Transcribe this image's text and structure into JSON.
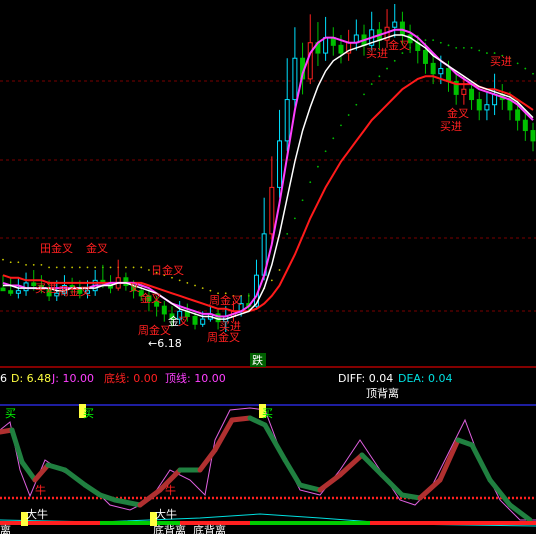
{
  "colors": {
    "background": "#000000",
    "grid": "#7a0000",
    "separator": "#b00000",
    "up_candle": "#00e0ff",
    "down_candle": "#00c000",
    "up_body_red": "#ff2020",
    "signal_bar": "#ffff40",
    "ma_white": "#ffffff",
    "ma_magenta": "#ff40ff",
    "ma_red": "#ff1a1a",
    "dot_line": "#c8c800",
    "label_red": "#ff2020",
    "osc_magenta": "#e060e0",
    "osc_up": "#b03030",
    "osc_down": "#208040",
    "blue_line": "#3030ff",
    "dea_cyan": "#00e0e0",
    "level_red": "#ff2020"
  },
  "upper_labels": [
    {
      "text": "田金叉",
      "key": "l1"
    },
    {
      "text": "金叉",
      "key": "l2"
    },
    {
      "text": "买进",
      "key": "l3"
    },
    {
      "text": "周金叉",
      "key": "l4"
    },
    {
      "text": "日金叉",
      "key": "l5"
    },
    {
      "text": "叉",
      "key": "l6"
    },
    {
      "text": "金叉",
      "key": "l7"
    },
    {
      "text": "周金叉",
      "key": "l8"
    },
    {
      "text": "买进",
      "key": "l9"
    },
    {
      "text": "周金叉",
      "key": "l10"
    },
    {
      "text": "金",
      "key": "l11"
    },
    {
      "text": "叉",
      "key": "l12"
    },
    {
      "text": "周金叉",
      "key": "l13"
    },
    {
      "text": "买进",
      "key": "l14"
    },
    {
      "text": "买进",
      "key": "l15"
    },
    {
      "text": "金叉",
      "key": "l16"
    },
    {
      "text": "买进",
      "key": "l17"
    },
    {
      "text": "金叉",
      "key": "l18"
    }
  ],
  "low_price_label": "←6.18",
  "down_marker": "跌",
  "indicator_header": {
    "k_prefix": "6",
    "d_label": "D: 6.48",
    "j_label": "J: 10.00",
    "bottom_line_label": "底线: 0.00",
    "top_line_label": "顶线: 10.00",
    "diff_label": "DIFF: 0.04",
    "dea_label": "DEA: 0.04",
    "top_divergence": "顶背离"
  },
  "osc_markers": {
    "buy1": "买",
    "buy2": "买",
    "buy3": "买",
    "bull1_red": "牛",
    "bull2_red": "牛",
    "bull1": "大牛",
    "bull2": "大牛",
    "bottom_div1": "底背离",
    "bottom_div2": "底背离",
    "edge_text": "离"
  },
  "chart_data": {
    "type": "candlestick",
    "candles": [
      [
        9,
        8,
        14,
        8
      ],
      [
        8,
        7,
        13,
        6
      ],
      [
        7,
        8,
        13,
        5
      ],
      [
        8,
        11,
        15,
        6
      ],
      [
        11,
        10,
        16,
        8
      ],
      [
        10,
        9,
        14,
        7
      ],
      [
        9,
        6,
        12,
        4
      ],
      [
        6,
        7,
        12,
        4
      ],
      [
        7,
        10,
        14,
        6
      ],
      [
        10,
        9,
        13,
        7
      ],
      [
        9,
        7,
        12,
        5
      ],
      [
        7,
        8,
        12,
        5
      ],
      [
        8,
        12,
        16,
        6
      ],
      [
        12,
        11,
        18,
        9
      ],
      [
        11,
        9,
        14,
        7
      ],
      [
        9,
        13,
        20,
        8
      ],
      [
        13,
        10,
        15,
        8
      ],
      [
        10,
        8,
        12,
        5
      ],
      [
        8,
        6,
        11,
        4
      ],
      [
        6,
        4,
        9,
        0
      ],
      [
        4,
        2,
        6,
        -2
      ],
      [
        2,
        -1,
        4,
        -4
      ],
      [
        -1,
        -3,
        2,
        -6
      ],
      [
        -3,
        0,
        4,
        -5
      ],
      [
        0,
        -2,
        3,
        -4
      ],
      [
        -2,
        -5,
        0,
        -7
      ],
      [
        -5,
        -3,
        0,
        -6
      ],
      [
        -3,
        -1,
        2,
        -4
      ],
      [
        -1,
        -4,
        1,
        -7
      ],
      [
        -4,
        -2,
        2,
        -8
      ],
      [
        -2,
        0,
        4,
        -4
      ],
      [
        0,
        3,
        6,
        -2
      ],
      [
        3,
        2,
        7,
        0
      ],
      [
        2,
        14,
        20,
        1
      ],
      [
        14,
        30,
        44,
        12
      ],
      [
        30,
        48,
        60,
        27
      ],
      [
        48,
        66,
        78,
        44
      ],
      [
        66,
        82,
        98,
        62
      ],
      [
        82,
        98,
        110,
        78
      ],
      [
        98,
        90,
        104,
        84
      ],
      [
        90,
        104,
        115,
        88
      ],
      [
        104,
        100,
        112,
        95
      ],
      [
        100,
        106,
        114,
        97
      ],
      [
        106,
        103,
        110,
        99
      ],
      [
        103,
        100,
        107,
        96
      ],
      [
        100,
        104,
        109,
        97
      ],
      [
        104,
        107,
        113,
        101
      ],
      [
        107,
        103,
        111,
        99
      ],
      [
        103,
        109,
        116,
        101
      ],
      [
        109,
        105,
        112,
        101
      ],
      [
        105,
        110,
        117,
        102
      ],
      [
        110,
        112,
        119,
        106
      ],
      [
        112,
        107,
        116,
        103
      ],
      [
        107,
        104,
        111,
        100
      ],
      [
        104,
        101,
        107,
        96
      ],
      [
        101,
        96,
        104,
        92
      ],
      [
        96,
        92,
        100,
        88
      ],
      [
        92,
        94,
        99,
        88
      ],
      [
        94,
        89,
        97,
        85
      ],
      [
        89,
        84,
        92,
        80
      ],
      [
        84,
        86,
        91,
        80
      ],
      [
        86,
        82,
        89,
        78
      ],
      [
        82,
        78,
        85,
        74
      ],
      [
        78,
        80,
        85,
        74
      ],
      [
        80,
        84,
        92,
        76
      ],
      [
        84,
        82,
        88,
        78
      ],
      [
        82,
        78,
        85,
        74
      ],
      [
        78,
        74,
        82,
        70
      ],
      [
        74,
        70,
        77,
        66
      ],
      [
        70,
        66,
        73,
        62
      ]
    ],
    "ma_white": [
      10,
      10,
      9,
      9,
      9,
      9,
      9,
      8,
      8,
      9,
      9,
      9,
      9,
      10,
      10,
      11,
      11,
      10,
      9,
      8,
      7,
      5,
      3,
      1,
      0,
      -1,
      -2,
      -2,
      -3,
      -3,
      -2,
      -1,
      0,
      3,
      9,
      18,
      30,
      44,
      58,
      70,
      79,
      87,
      93,
      97,
      99,
      101,
      102,
      103,
      104,
      105,
      106,
      107,
      107,
      106,
      104,
      102,
      99,
      97,
      95,
      93,
      91,
      89,
      87,
      86,
      85,
      84,
      83,
      81,
      78,
      75
    ],
    "ma_magenta": [
      11,
      10,
      10,
      9,
      9,
      9,
      9,
      9,
      9,
      9,
      9,
      9,
      10,
      10,
      11,
      11,
      11,
      11,
      10,
      9,
      7,
      5,
      3,
      2,
      1,
      0,
      -1,
      -1,
      -2,
      -2,
      -1,
      0,
      2,
      6,
      14,
      26,
      42,
      60,
      78,
      92,
      100,
      104,
      106,
      106,
      105,
      104,
      104,
      105,
      106,
      107,
      108,
      109,
      109,
      108,
      106,
      103,
      100,
      97,
      95,
      92,
      90,
      88,
      86,
      85,
      84,
      83,
      82,
      80,
      77,
      74
    ],
    "ma_red": [
      14,
      13,
      13,
      12,
      12,
      12,
      11,
      11,
      11,
      11,
      11,
      11,
      11,
      11,
      11,
      11,
      11,
      11,
      11,
      10,
      9,
      8,
      7,
      6,
      5,
      4,
      3,
      2,
      1,
      1,
      0,
      0,
      0,
      1,
      3,
      6,
      10,
      16,
      22,
      29,
      36,
      42,
      48,
      53,
      58,
      62,
      66,
      70,
      74,
      77,
      80,
      83,
      86,
      88,
      90,
      91,
      91,
      90,
      89,
      88,
      88,
      88,
      87,
      86,
      86,
      85,
      84,
      82,
      80,
      78
    ]
  }
}
